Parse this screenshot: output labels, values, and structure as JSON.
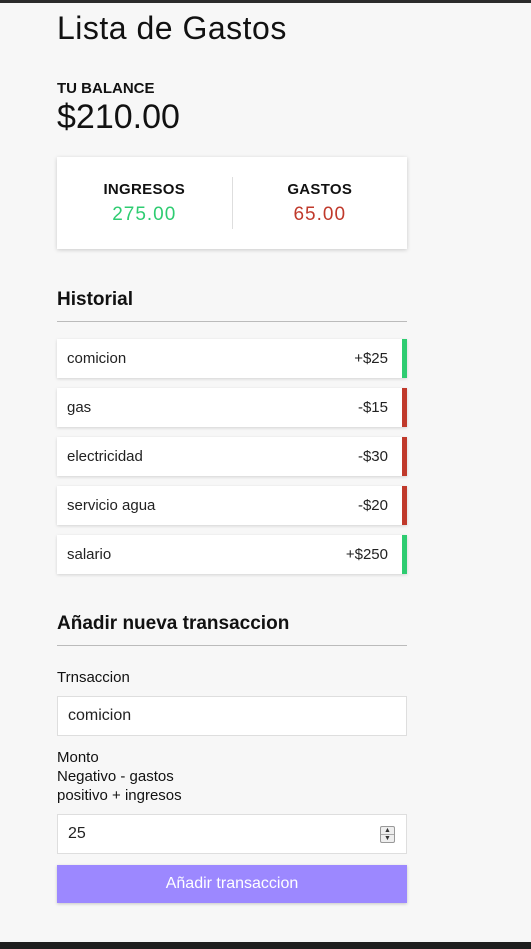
{
  "title": "Lista de Gastos",
  "balance": {
    "label": "TU BALANCE",
    "value": "$210.00"
  },
  "summary": {
    "income_label": "INGRESOS",
    "income_value": "275.00",
    "expense_label": "GASTOS",
    "expense_value": "65.00"
  },
  "history": {
    "title": "Historial",
    "items": [
      {
        "text": "comicion",
        "amount": "+$25",
        "type": "plus"
      },
      {
        "text": "gas",
        "amount": "-$15",
        "type": "minus"
      },
      {
        "text": "electricidad",
        "amount": "-$30",
        "type": "minus"
      },
      {
        "text": "servicio agua",
        "amount": "-$20",
        "type": "minus"
      },
      {
        "text": "salario",
        "amount": "+$250",
        "type": "plus"
      }
    ]
  },
  "form": {
    "title": "Añadir nueva transaccion",
    "text_label": "Trnsaccion",
    "text_value": "comicion",
    "amount_label_1": "Monto",
    "amount_label_2": "Negativo - gastos",
    "amount_label_3": "positivo + ingresos",
    "amount_value": "25",
    "submit_label": "Añadir transaccion"
  },
  "colors": {
    "income": "#2ecc71",
    "expense": "#c0392b",
    "button": "#9c88ff"
  }
}
